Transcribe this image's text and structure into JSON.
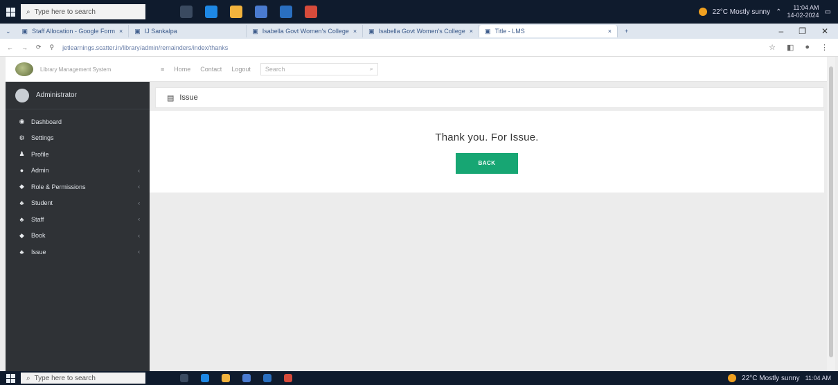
{
  "taskbar": {
    "search_placeholder": "Type here to search",
    "weather": "22°C Mostly sunny",
    "clock_time": "11:04 AM",
    "clock_date": "14-02-2024",
    "apps": [
      {
        "name": "task-view",
        "color": "#3a4a60"
      },
      {
        "name": "edge",
        "color": "#1e88e5"
      },
      {
        "name": "file-explorer",
        "color": "#f2b33d"
      },
      {
        "name": "store",
        "color": "#4a7bd0"
      },
      {
        "name": "mail",
        "color": "#2a6fc0"
      },
      {
        "name": "chrome",
        "color": "#d64b3b"
      }
    ]
  },
  "browser": {
    "tabs": [
      {
        "label": "Staff Allocation - Google Form"
      },
      {
        "label": "IJ Sankalpa"
      },
      {
        "label": "Isabella Govt Women's College"
      },
      {
        "label": "Isabella Govt Women's College"
      },
      {
        "label": "Title - LMS"
      }
    ],
    "url": "jetlearnings.scatter.in/library/admin/remainders/index/thanks",
    "window_controls": [
      "–",
      "❐",
      "✕"
    ]
  },
  "sidebar": {
    "brand": "Library Management System",
    "user_name": "Administrator",
    "items": [
      {
        "label": "Dashboard",
        "icon": "dashboard-icon",
        "has_arrow": false
      },
      {
        "label": "Settings",
        "icon": "settings-icon",
        "has_arrow": false
      },
      {
        "label": "Profile",
        "icon": "profile-icon",
        "has_arrow": false
      },
      {
        "label": "Admin",
        "icon": "admin-icon",
        "has_arrow": true
      },
      {
        "label": "Role & Permissions",
        "icon": "role-icon",
        "has_arrow": true
      },
      {
        "label": "Student",
        "icon": "student-icon",
        "has_arrow": true
      },
      {
        "label": "Staff",
        "icon": "staff-icon",
        "has_arrow": true
      },
      {
        "label": "Book",
        "icon": "book-icon",
        "has_arrow": true
      },
      {
        "label": "Issue",
        "icon": "issue-icon",
        "has_arrow": true
      }
    ]
  },
  "navbar": {
    "menu_icon": "≡",
    "links": [
      "Home",
      "Contact",
      "Logout"
    ],
    "search_placeholder": "Search"
  },
  "panel": {
    "title": "Issue",
    "message": "Thank you. For Issue.",
    "back_label": "BACK"
  },
  "colors": {
    "sidebar_bg": "#2f3236",
    "back_button": "#17a673"
  }
}
